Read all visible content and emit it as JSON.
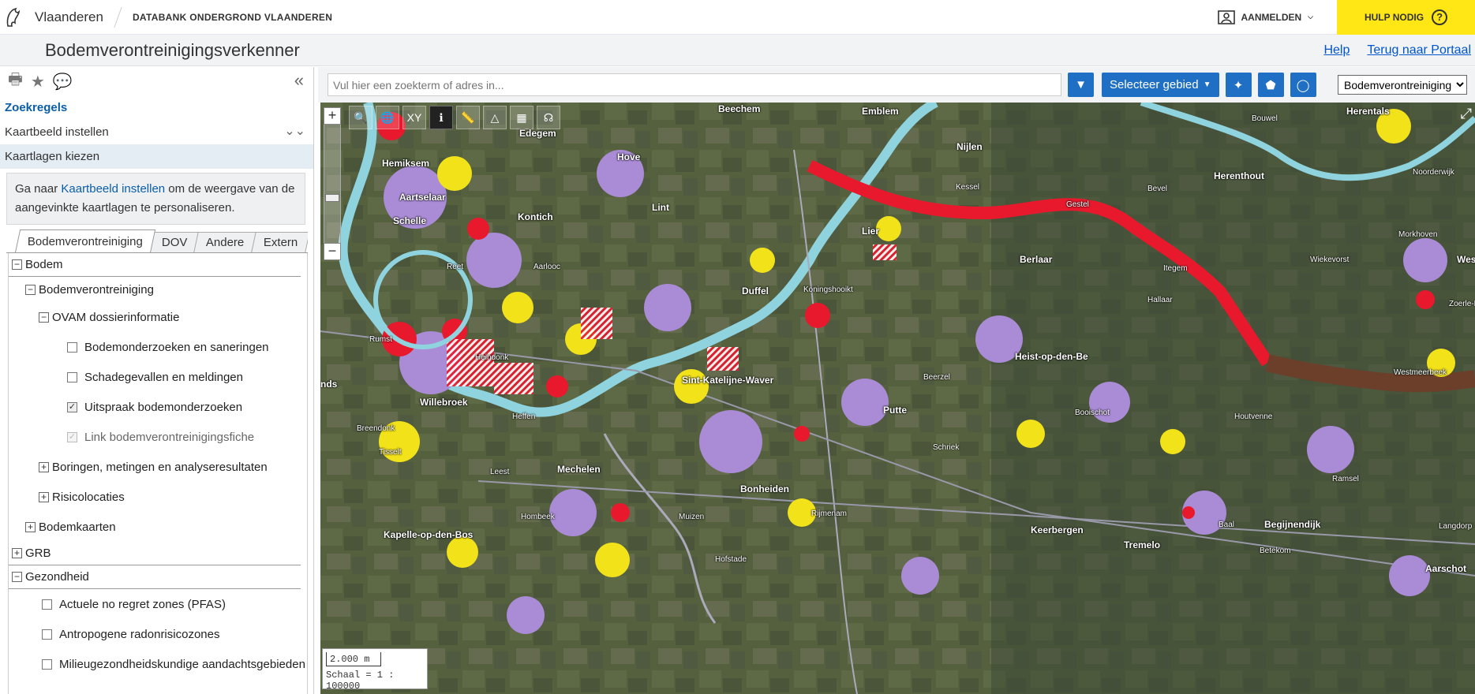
{
  "header": {
    "brand": "Vlaanderen",
    "portal": "DATABANK ONDERGROND VLAANDEREN",
    "login_label": "AANMELDEN",
    "help_label": "HULP NODIG",
    "help_icon": "?"
  },
  "titlebar": {
    "title": "Bodemverontreinigingsverkenner",
    "links": [
      "Help",
      "Terug naar Portaal"
    ]
  },
  "sidebar": {
    "zoekregels": "Zoekregels",
    "kaartbeeld": "Kaartbeeld instellen",
    "kaartlagen": "Kaartlagen kiezen",
    "info_prefix": "Ga naar ",
    "info_link": "Kaartbeeld instellen",
    "info_suffix": " om de weergave van de aangevinkte kaartlagen te personaliseren.",
    "tabs": [
      "Bodemverontreiniging",
      "DOV",
      "Andere",
      "Extern"
    ],
    "tree": {
      "bodem": "Bodem",
      "bodemverontreiniging": "Bodemverontreiniging",
      "ovam": "OVAM dossierinformatie",
      "layer1": "Bodemonderzoeken en saneringen",
      "layer2": "Schadegevallen en meldingen",
      "layer3": "Uitspraak bodemonderzoeken",
      "layer4": "Link bodemverontreinigingsfiche",
      "boringen": "Boringen, metingen en analyseresultaten",
      "risico": "Risicolocaties",
      "bodemkaarten": "Bodemkaarten",
      "grb": "GRB",
      "gezondheid": "Gezondheid",
      "g1": "Actuele no regret zones (PFAS)",
      "g2": "Antropogene radonrisicozones",
      "g3": "Milieugezondheidskundige aandachtsgebieden"
    }
  },
  "search": {
    "placeholder": "Vul hier een zoekterm of adres in...",
    "select_area": "Selecteer gebied",
    "layer_select": "Bodemverontreiniging"
  },
  "map": {
    "tools": [
      "XY"
    ],
    "scale_bar": "2.000 m",
    "scale_text": "Schaal = 1 : 100000",
    "places": {
      "hemiksem": "Hemiksem",
      "schelle": "Schelle",
      "aartselaar": "Aartselaar",
      "kontich": "Kontich",
      "lint": "Lint",
      "hove": "Hove",
      "edegem": "Edegem",
      "lier": "Lier",
      "duffel": "Duffel",
      "reet": "Reet",
      "aartselaar2": "Aarlooc",
      "willebroek": "Willebroek",
      "heffen": "Heffen",
      "mechelen": "Mechelen",
      "bonheiden": "Bonheiden",
      "putte": "Putte",
      "berlaar": "Berlaar",
      "nijlen": "Nijlen",
      "herenthout": "Herenthout",
      "heist": "Heist-op-den-Be",
      "keerbergen": "Keerbergen",
      "tremelo": "Tremelo",
      "begijnendijk": "Begijnendijk",
      "aarschot": "Aarschot",
      "herentals": "Herentals",
      "emblem": "Emblem",
      "kessel": "Kessel",
      "bouwel": "Bouwel",
      "beerzel": "Beerzel",
      "schriek": "Schriek",
      "kapelle": "Kapelle-op-den-Bos",
      "leest": "Leest",
      "hombeek": "Hombeek",
      "muizen": "Muizen",
      "rijmenam": "Rijmenam",
      "baal": "Baal",
      "itegem": "Itegem",
      "hallaar": "Hallaar",
      "booischot": "Booischot",
      "houtvenne": "Houtvenne",
      "wiekevorst": "Wiekevorst",
      "morkhoven": "Morkhoven",
      "noorderwijk": "Noorderwijk",
      "ramsel": "Ramsel",
      "westmeerbeek": "Westmeerbeek",
      "langdorp": "Langdorp",
      "betekom": "Betekom",
      "hofstade": "Hofstade",
      "tisselt": "Tisselt",
      "breendonk": "Breendonk",
      "rumst": "Rumst",
      "heindonk": "Heindonk",
      "beechem": "Beechem",
      "konings": "Koningshooikt",
      "bevel": "Bevel",
      "gestel": "Gestel",
      "zoerle": "Zoerle-Pa",
      "wes": "Wes",
      "sint": "Sint-Katelijne-Waver",
      "nds": "nds"
    }
  },
  "colors": {
    "accent": "#1f6fc4",
    "help_bg": "#ffe615",
    "red": "#e8192c",
    "yellow": "#f2e21a",
    "purple": "#a98bd6",
    "brown": "#6b3f2a"
  }
}
